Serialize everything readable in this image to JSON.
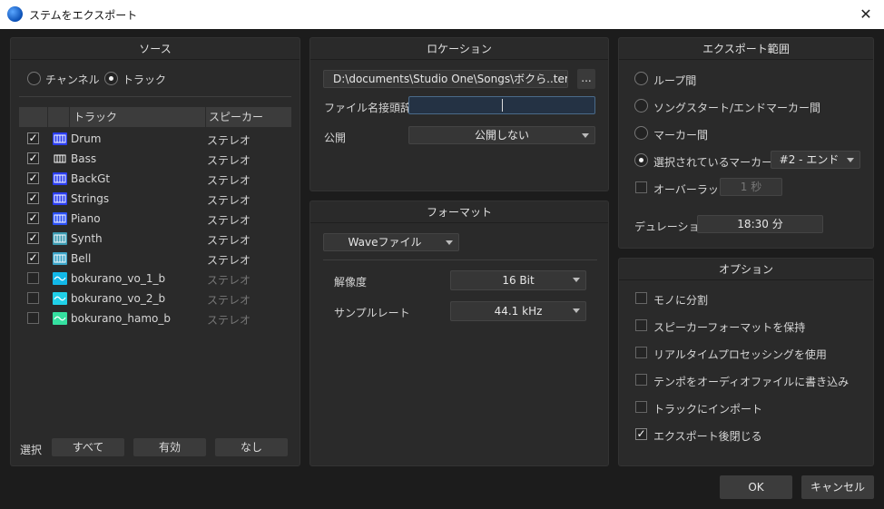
{
  "window": {
    "title": "ステムをエクスポート",
    "close_glyph": "✕"
  },
  "source": {
    "header": "ソース",
    "radio_channel": "チャンネル",
    "radio_track": "トラック",
    "col_track": "トラック",
    "col_speaker": "スピーカー",
    "tracks": [
      {
        "name": "Drum",
        "speaker": "ステレオ",
        "checked": true,
        "icon": "keys-icon",
        "color": "#2a3df0"
      },
      {
        "name": "Bass",
        "speaker": "ステレオ",
        "checked": true,
        "icon": "keys-icon",
        "color": "#2a2a2a"
      },
      {
        "name": "BackGt",
        "speaker": "ステレオ",
        "checked": true,
        "icon": "keys-icon",
        "color": "#2a3df0"
      },
      {
        "name": "Strings",
        "speaker": "ステレオ",
        "checked": true,
        "icon": "keys-icon",
        "color": "#2a3df0"
      },
      {
        "name": "Piano",
        "speaker": "ステレオ",
        "checked": true,
        "icon": "keys-icon",
        "color": "#2a4ff5"
      },
      {
        "name": "Synth",
        "speaker": "ステレオ",
        "checked": true,
        "icon": "keys-icon",
        "color": "#3a9ab0"
      },
      {
        "name": "Bell",
        "speaker": "ステレオ",
        "checked": true,
        "icon": "keys-icon",
        "color": "#3aa4c8"
      },
      {
        "name": "bokurano_vo_1_b",
        "speaker": "ステレオ",
        "checked": false,
        "icon": "wave-icon",
        "color": "#12b8e8"
      },
      {
        "name": "bokurano_vo_2_b",
        "speaker": "ステレオ",
        "checked": false,
        "icon": "wave-icon",
        "color": "#20d0e8"
      },
      {
        "name": "bokurano_hamo_b",
        "speaker": "ステレオ",
        "checked": false,
        "icon": "wave-icon",
        "color": "#35e0a0"
      }
    ],
    "select_label": "選択",
    "btn_all": "すべて",
    "btn_enabled": "有効",
    "btn_none": "なし"
  },
  "location": {
    "header": "ロケーション",
    "path": "D:\\documents\\Studio One\\Songs\\ボクら..tems",
    "browse": "...",
    "prefix_label": "ファイル名接頭辞",
    "prefix_value": "",
    "publish_label": "公開",
    "publish_value": "公開しない"
  },
  "format": {
    "header": "フォーマット",
    "type": "Waveファイル",
    "resolution_label": "解像度",
    "resolution_value": "16 Bit",
    "samplerate_label": "サンプルレート",
    "samplerate_value": "44.1 kHz"
  },
  "range": {
    "header": "エクスポート範囲",
    "opt_loop": "ループ間",
    "opt_song": "ソングスタート/エンドマーカー間",
    "opt_marker": "マーカー間",
    "opt_selected": "選択されているマーカー間",
    "selected_marker": "#2 - エンド",
    "overlap_label": "オーバーラップ",
    "overlap_value": "1 秒",
    "duration_label": "デュレーション",
    "duration_value": "18:30 分"
  },
  "options": {
    "header": "オプション",
    "items": [
      {
        "label": "モノに分割",
        "checked": false
      },
      {
        "label": "スピーカーフォーマットを保持",
        "checked": false
      },
      {
        "label": "リアルタイムプロセッシングを使用",
        "checked": false
      },
      {
        "label": "テンポをオーディオファイルに書き込み",
        "checked": false
      },
      {
        "label": "トラックにインポート",
        "checked": false
      },
      {
        "label": "エクスポート後閉じる",
        "checked": true
      }
    ]
  },
  "footer": {
    "ok": "OK",
    "cancel": "キャンセル"
  }
}
